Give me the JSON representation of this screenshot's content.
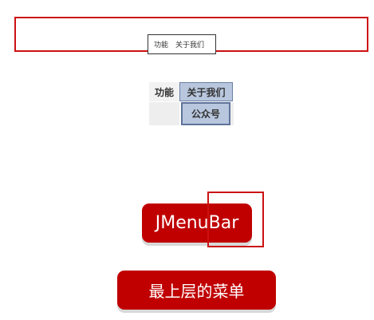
{
  "small_menubar": {
    "item1": "功能",
    "item2": "关于我们"
  },
  "menu_demo": {
    "menu1": "功能",
    "menu2": "关于我们",
    "submenu_item": "公众号"
  },
  "labels": {
    "jmenubar": "JMenuBar",
    "top_menu": "最上层的菜单"
  },
  "colors": {
    "highlight_frame": "#cc1111",
    "pill_background": "#c00000",
    "menu_selected": "#b8c7de"
  }
}
